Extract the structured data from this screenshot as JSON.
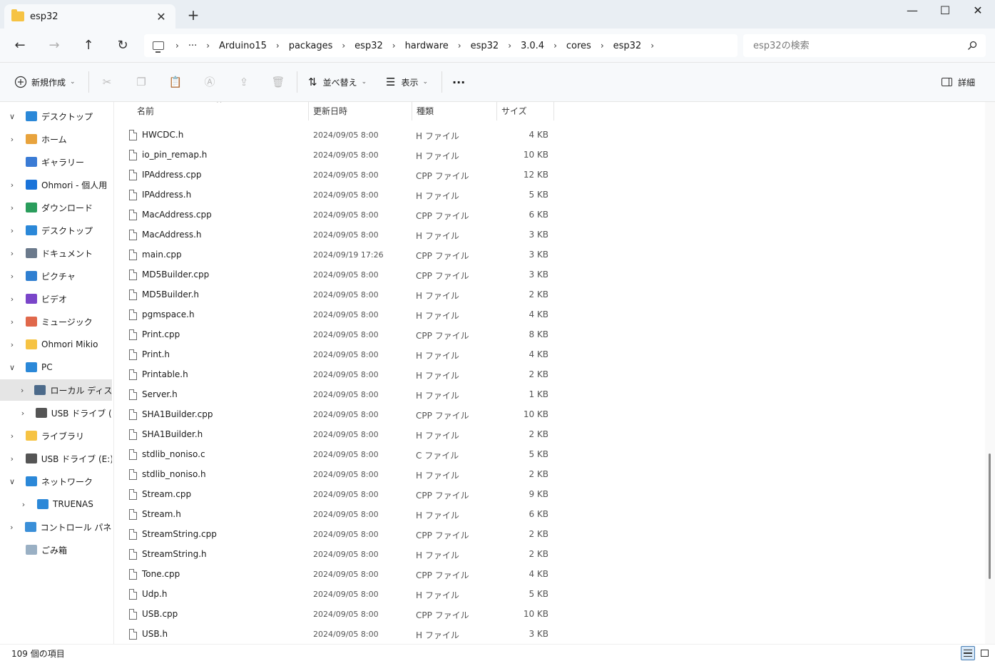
{
  "window": {
    "tab_title": "esp32",
    "tab_close": "✕",
    "new_tab": "+",
    "minimize": "—",
    "maximize": "☐",
    "close": "✕"
  },
  "nav": {
    "back": "←",
    "forward": "→",
    "up": "↑",
    "refresh": "↻"
  },
  "breadcrumb": {
    "overflow": "···",
    "separator": "›",
    "items": [
      "Arduino15",
      "packages",
      "esp32",
      "hardware",
      "esp32",
      "3.0.4",
      "cores",
      "esp32"
    ]
  },
  "search": {
    "placeholder": "esp32の検索"
  },
  "toolbar": {
    "new_label": "新規作成",
    "sort_label": "並べ替え",
    "view_label": "表示",
    "more_label": "···",
    "details_label": "詳細",
    "chevron": "⌄",
    "cut_icon": "scissors-icon",
    "copy_icon": "copy-icon",
    "paste_icon": "paste-icon",
    "rename_icon": "rename-icon",
    "share_icon": "share-icon",
    "delete_icon": "trash-icon"
  },
  "sidebar": {
    "items": [
      {
        "label": "デスクトップ",
        "expander": "∨",
        "icon": "desktop-icon",
        "color": "#2b88d8"
      },
      {
        "label": "ホーム",
        "expander": "›",
        "icon": "home-icon",
        "color": "#e8a33d"
      },
      {
        "label": "ギャラリー",
        "expander": "",
        "icon": "gallery-icon",
        "color": "#3a7bd5"
      },
      {
        "label": "Ohmori - 個人用",
        "expander": "›",
        "icon": "onedrive-icon",
        "color": "#1a73d9"
      },
      {
        "label": "ダウンロード",
        "expander": "›",
        "icon": "download-icon",
        "color": "#2a9d5c"
      },
      {
        "label": "デスクトップ",
        "expander": "›",
        "icon": "desktop-icon",
        "color": "#2b88d8"
      },
      {
        "label": "ドキュメント",
        "expander": "›",
        "icon": "documents-icon",
        "color": "#6b7a8c"
      },
      {
        "label": "ピクチャ",
        "expander": "›",
        "icon": "pictures-icon",
        "color": "#2f7fd1"
      },
      {
        "label": "ビデオ",
        "expander": "›",
        "icon": "videos-icon",
        "color": "#7a45c9"
      },
      {
        "label": "ミュージック",
        "expander": "›",
        "icon": "music-icon",
        "color": "#e0684b"
      },
      {
        "label": "Ohmori Mikio",
        "expander": "›",
        "icon": "folder-icon",
        "color": "#f6c343"
      },
      {
        "label": "PC",
        "expander": "∨",
        "icon": "pc-icon",
        "color": "#2b88d8"
      },
      {
        "label": "ローカル ディスク (C",
        "expander": "›",
        "icon": "drive-icon",
        "color": "#4c6a8a"
      },
      {
        "label": "USB ドライブ (E:)",
        "expander": "›",
        "icon": "usb-drive-icon",
        "color": "#555555"
      },
      {
        "label": "ライブラリ",
        "expander": "›",
        "icon": "library-icon",
        "color": "#f6c343"
      },
      {
        "label": "USB ドライブ (E:)",
        "expander": "›",
        "icon": "usb-drive-icon",
        "color": "#555555"
      },
      {
        "label": "ネットワーク",
        "expander": "∨",
        "icon": "network-icon",
        "color": "#2b88d8"
      },
      {
        "label": "TRUENAS",
        "expander": "›",
        "icon": "server-icon",
        "color": "#2b88d8"
      },
      {
        "label": "コントロール パネル",
        "expander": "›",
        "icon": "control-panel-icon",
        "color": "#3a8fd8"
      },
      {
        "label": "ごみ箱",
        "expander": "",
        "icon": "recycle-bin-icon",
        "color": "#9ab0c4"
      }
    ]
  },
  "columns": {
    "name": "名前",
    "date": "更新日時",
    "type": "種類",
    "size": "サイズ",
    "sort_arrow": "^"
  },
  "files": [
    {
      "name": "HWCDC.h",
      "date": "2024/09/05 8:00",
      "type": "H ファイル",
      "size": "4 KB"
    },
    {
      "name": "io_pin_remap.h",
      "date": "2024/09/05 8:00",
      "type": "H ファイル",
      "size": "10 KB"
    },
    {
      "name": "IPAddress.cpp",
      "date": "2024/09/05 8:00",
      "type": "CPP ファイル",
      "size": "12 KB"
    },
    {
      "name": "IPAddress.h",
      "date": "2024/09/05 8:00",
      "type": "H ファイル",
      "size": "5 KB"
    },
    {
      "name": "MacAddress.cpp",
      "date": "2024/09/05 8:00",
      "type": "CPP ファイル",
      "size": "6 KB"
    },
    {
      "name": "MacAddress.h",
      "date": "2024/09/05 8:00",
      "type": "H ファイル",
      "size": "3 KB"
    },
    {
      "name": "main.cpp",
      "date": "2024/09/19 17:26",
      "type": "CPP ファイル",
      "size": "3 KB"
    },
    {
      "name": "MD5Builder.cpp",
      "date": "2024/09/05 8:00",
      "type": "CPP ファイル",
      "size": "3 KB"
    },
    {
      "name": "MD5Builder.h",
      "date": "2024/09/05 8:00",
      "type": "H ファイル",
      "size": "2 KB"
    },
    {
      "name": "pgmspace.h",
      "date": "2024/09/05 8:00",
      "type": "H ファイル",
      "size": "4 KB"
    },
    {
      "name": "Print.cpp",
      "date": "2024/09/05 8:00",
      "type": "CPP ファイル",
      "size": "8 KB"
    },
    {
      "name": "Print.h",
      "date": "2024/09/05 8:00",
      "type": "H ファイル",
      "size": "4 KB"
    },
    {
      "name": "Printable.h",
      "date": "2024/09/05 8:00",
      "type": "H ファイル",
      "size": "2 KB"
    },
    {
      "name": "Server.h",
      "date": "2024/09/05 8:00",
      "type": "H ファイル",
      "size": "1 KB"
    },
    {
      "name": "SHA1Builder.cpp",
      "date": "2024/09/05 8:00",
      "type": "CPP ファイル",
      "size": "10 KB"
    },
    {
      "name": "SHA1Builder.h",
      "date": "2024/09/05 8:00",
      "type": "H ファイル",
      "size": "2 KB"
    },
    {
      "name": "stdlib_noniso.c",
      "date": "2024/09/05 8:00",
      "type": "C ファイル",
      "size": "5 KB"
    },
    {
      "name": "stdlib_noniso.h",
      "date": "2024/09/05 8:00",
      "type": "H ファイル",
      "size": "2 KB"
    },
    {
      "name": "Stream.cpp",
      "date": "2024/09/05 8:00",
      "type": "CPP ファイル",
      "size": "9 KB"
    },
    {
      "name": "Stream.h",
      "date": "2024/09/05 8:00",
      "type": "H ファイル",
      "size": "6 KB"
    },
    {
      "name": "StreamString.cpp",
      "date": "2024/09/05 8:00",
      "type": "CPP ファイル",
      "size": "2 KB"
    },
    {
      "name": "StreamString.h",
      "date": "2024/09/05 8:00",
      "type": "H ファイル",
      "size": "2 KB"
    },
    {
      "name": "Tone.cpp",
      "date": "2024/09/05 8:00",
      "type": "CPP ファイル",
      "size": "4 KB"
    },
    {
      "name": "Udp.h",
      "date": "2024/09/05 8:00",
      "type": "H ファイル",
      "size": "5 KB"
    },
    {
      "name": "USB.cpp",
      "date": "2024/09/05 8:00",
      "type": "CPP ファイル",
      "size": "10 KB"
    },
    {
      "name": "USB.h",
      "date": "2024/09/05 8:00",
      "type": "H ファイル",
      "size": "3 KB"
    }
  ],
  "status": {
    "item_count": "109 個の項目"
  }
}
